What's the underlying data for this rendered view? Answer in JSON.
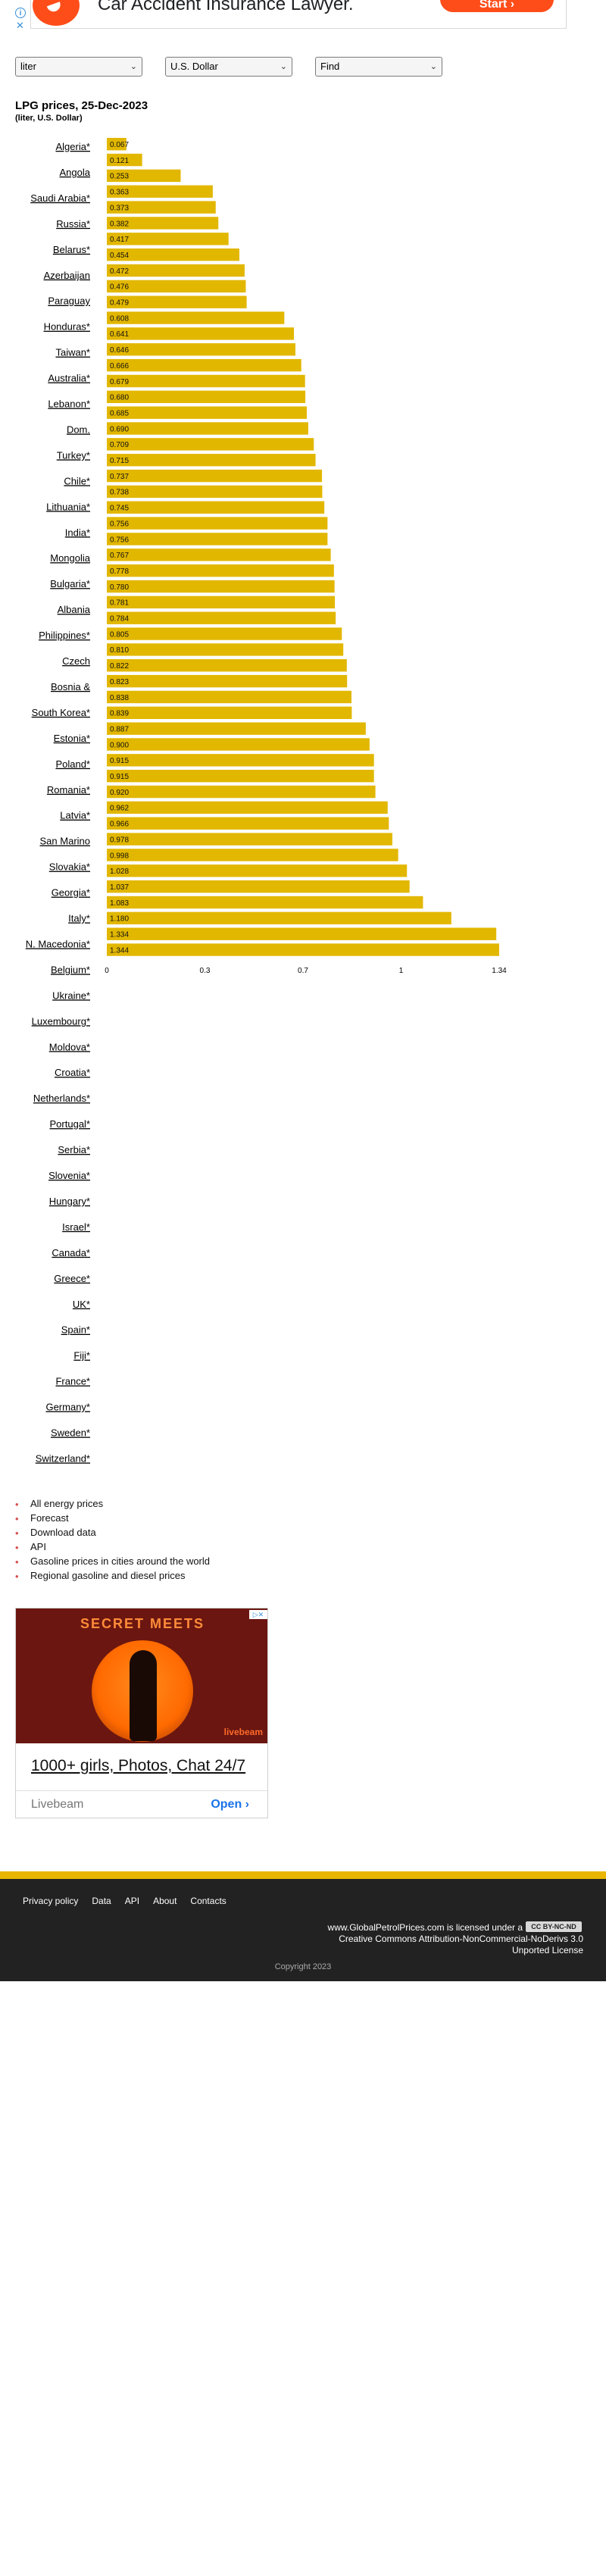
{
  "top_ad": {
    "headline": "Car Accident Insurance Lawyer.",
    "cta": "Start ›",
    "info_icon": "info-icon",
    "close_icon": "close-icon"
  },
  "selectors": {
    "product": "liter",
    "currency": "U.S. Dollar",
    "find": "Find"
  },
  "chart_data": {
    "type": "bar",
    "orientation": "horizontal",
    "title": "LPG prices, 25-Dec-2023",
    "subtitle": "(liter, U.S. Dollar)",
    "bar_color": "#e2b700",
    "categories": [
      "Algeria*",
      "Angola",
      "Saudi Arabia*",
      "Russia*",
      "Belarus*",
      "Azerbaijan",
      "Paraguay",
      "Honduras*",
      "Taiwan*",
      "Australia*",
      "Lebanon*",
      "Dom.",
      "Turkey*",
      "Chile*",
      "Lithuania*",
      "India*",
      "Mongolia",
      "Bulgaria*",
      "Albania",
      "Philippines*",
      "Czech",
      "Bosnia &",
      "South Korea*",
      "Estonia*",
      "Poland*",
      "Romania*",
      "Latvia*",
      "San Marino",
      "Slovakia*",
      "Georgia*",
      "Italy*",
      "N. Macedonia*",
      "Belgium*",
      "Ukraine*",
      "Luxembourg*",
      "Moldova*",
      "Croatia*",
      "Netherlands*",
      "Portugal*",
      "Serbia*",
      "Slovenia*",
      "Hungary*",
      "Israel*",
      "Canada*",
      "Greece*",
      "UK*",
      "Spain*",
      "Fiji*",
      "France*",
      "Germany*",
      "Sweden*",
      "Switzerland*"
    ],
    "values": [
      0.067,
      0.121,
      0.253,
      0.363,
      0.373,
      0.382,
      0.417,
      0.454,
      0.472,
      0.476,
      0.479,
      0.608,
      0.641,
      0.646,
      0.666,
      0.679,
      0.68,
      0.685,
      0.69,
      0.709,
      0.715,
      0.737,
      0.738,
      0.745,
      0.756,
      0.756,
      0.767,
      0.778,
      0.78,
      0.781,
      0.784,
      0.805,
      0.81,
      0.822,
      0.823,
      0.838,
      0.839,
      0.887,
      0.9,
      0.915,
      0.915,
      0.92,
      0.962,
      0.966,
      0.978,
      0.998,
      1.028,
      1.037,
      1.083,
      1.18,
      1.334,
      1.344
    ],
    "value_labels": [
      "0.067",
      "0.121",
      "0.253",
      "0.363",
      "0.373",
      "0.382",
      "0.417",
      "0.454",
      "0.472",
      "0.476",
      "0.479",
      "0.608",
      "0.641",
      "0.646",
      "0.666",
      "0.679",
      "0.680",
      "0.685",
      "0.690",
      "0.709",
      "0.715",
      "0.737",
      "0.738",
      "0.745",
      "0.756",
      "0.756",
      "0.767",
      "0.778",
      "0.780",
      "0.781",
      "0.784",
      "0.805",
      "0.810",
      "0.822",
      "0.823",
      "0.838",
      "0.839",
      "0.887",
      "0.900",
      "0.915",
      "0.915",
      "0.920",
      "0.962",
      "0.966",
      "0.978",
      "0.998",
      "1.028",
      "1.037",
      "1.083",
      "1.180",
      "1.334",
      "1.344"
    ],
    "xlim": [
      0,
      1.344
    ],
    "x_ticks": [
      {
        "value": 0,
        "label": "0"
      },
      {
        "value": 0.336,
        "label": "0.3"
      },
      {
        "value": 0.672,
        "label": "0.7"
      },
      {
        "value": 1.008,
        "label": "1"
      },
      {
        "value": 1.344,
        "label": "1.34"
      }
    ],
    "grid": false,
    "legend": "none"
  },
  "links": [
    "All energy prices",
    "Forecast",
    "Download data",
    "API",
    "Gasoline prices in cities around the world",
    "Regional gasoline and diesel prices"
  ],
  "ad2": {
    "image_title": "SECRET MEETS",
    "image_brand": "livebeam",
    "headline": "1000+ girls, Photos, Chat 24/7",
    "brand": "Livebeam",
    "cta": "Open ›"
  },
  "footer": {
    "nav": [
      "Privacy policy",
      "Data",
      "API",
      "About",
      "Contacts"
    ],
    "license_line1": "www.GlobalPetrolPrices.com is licensed under a",
    "cc_badge": "CC BY-NC-ND",
    "license_line2": "Creative Commons Attribution-NonCommercial-NoDerivs 3.0",
    "license_line3": "Unported License",
    "copyright": "Copyright 2023"
  }
}
